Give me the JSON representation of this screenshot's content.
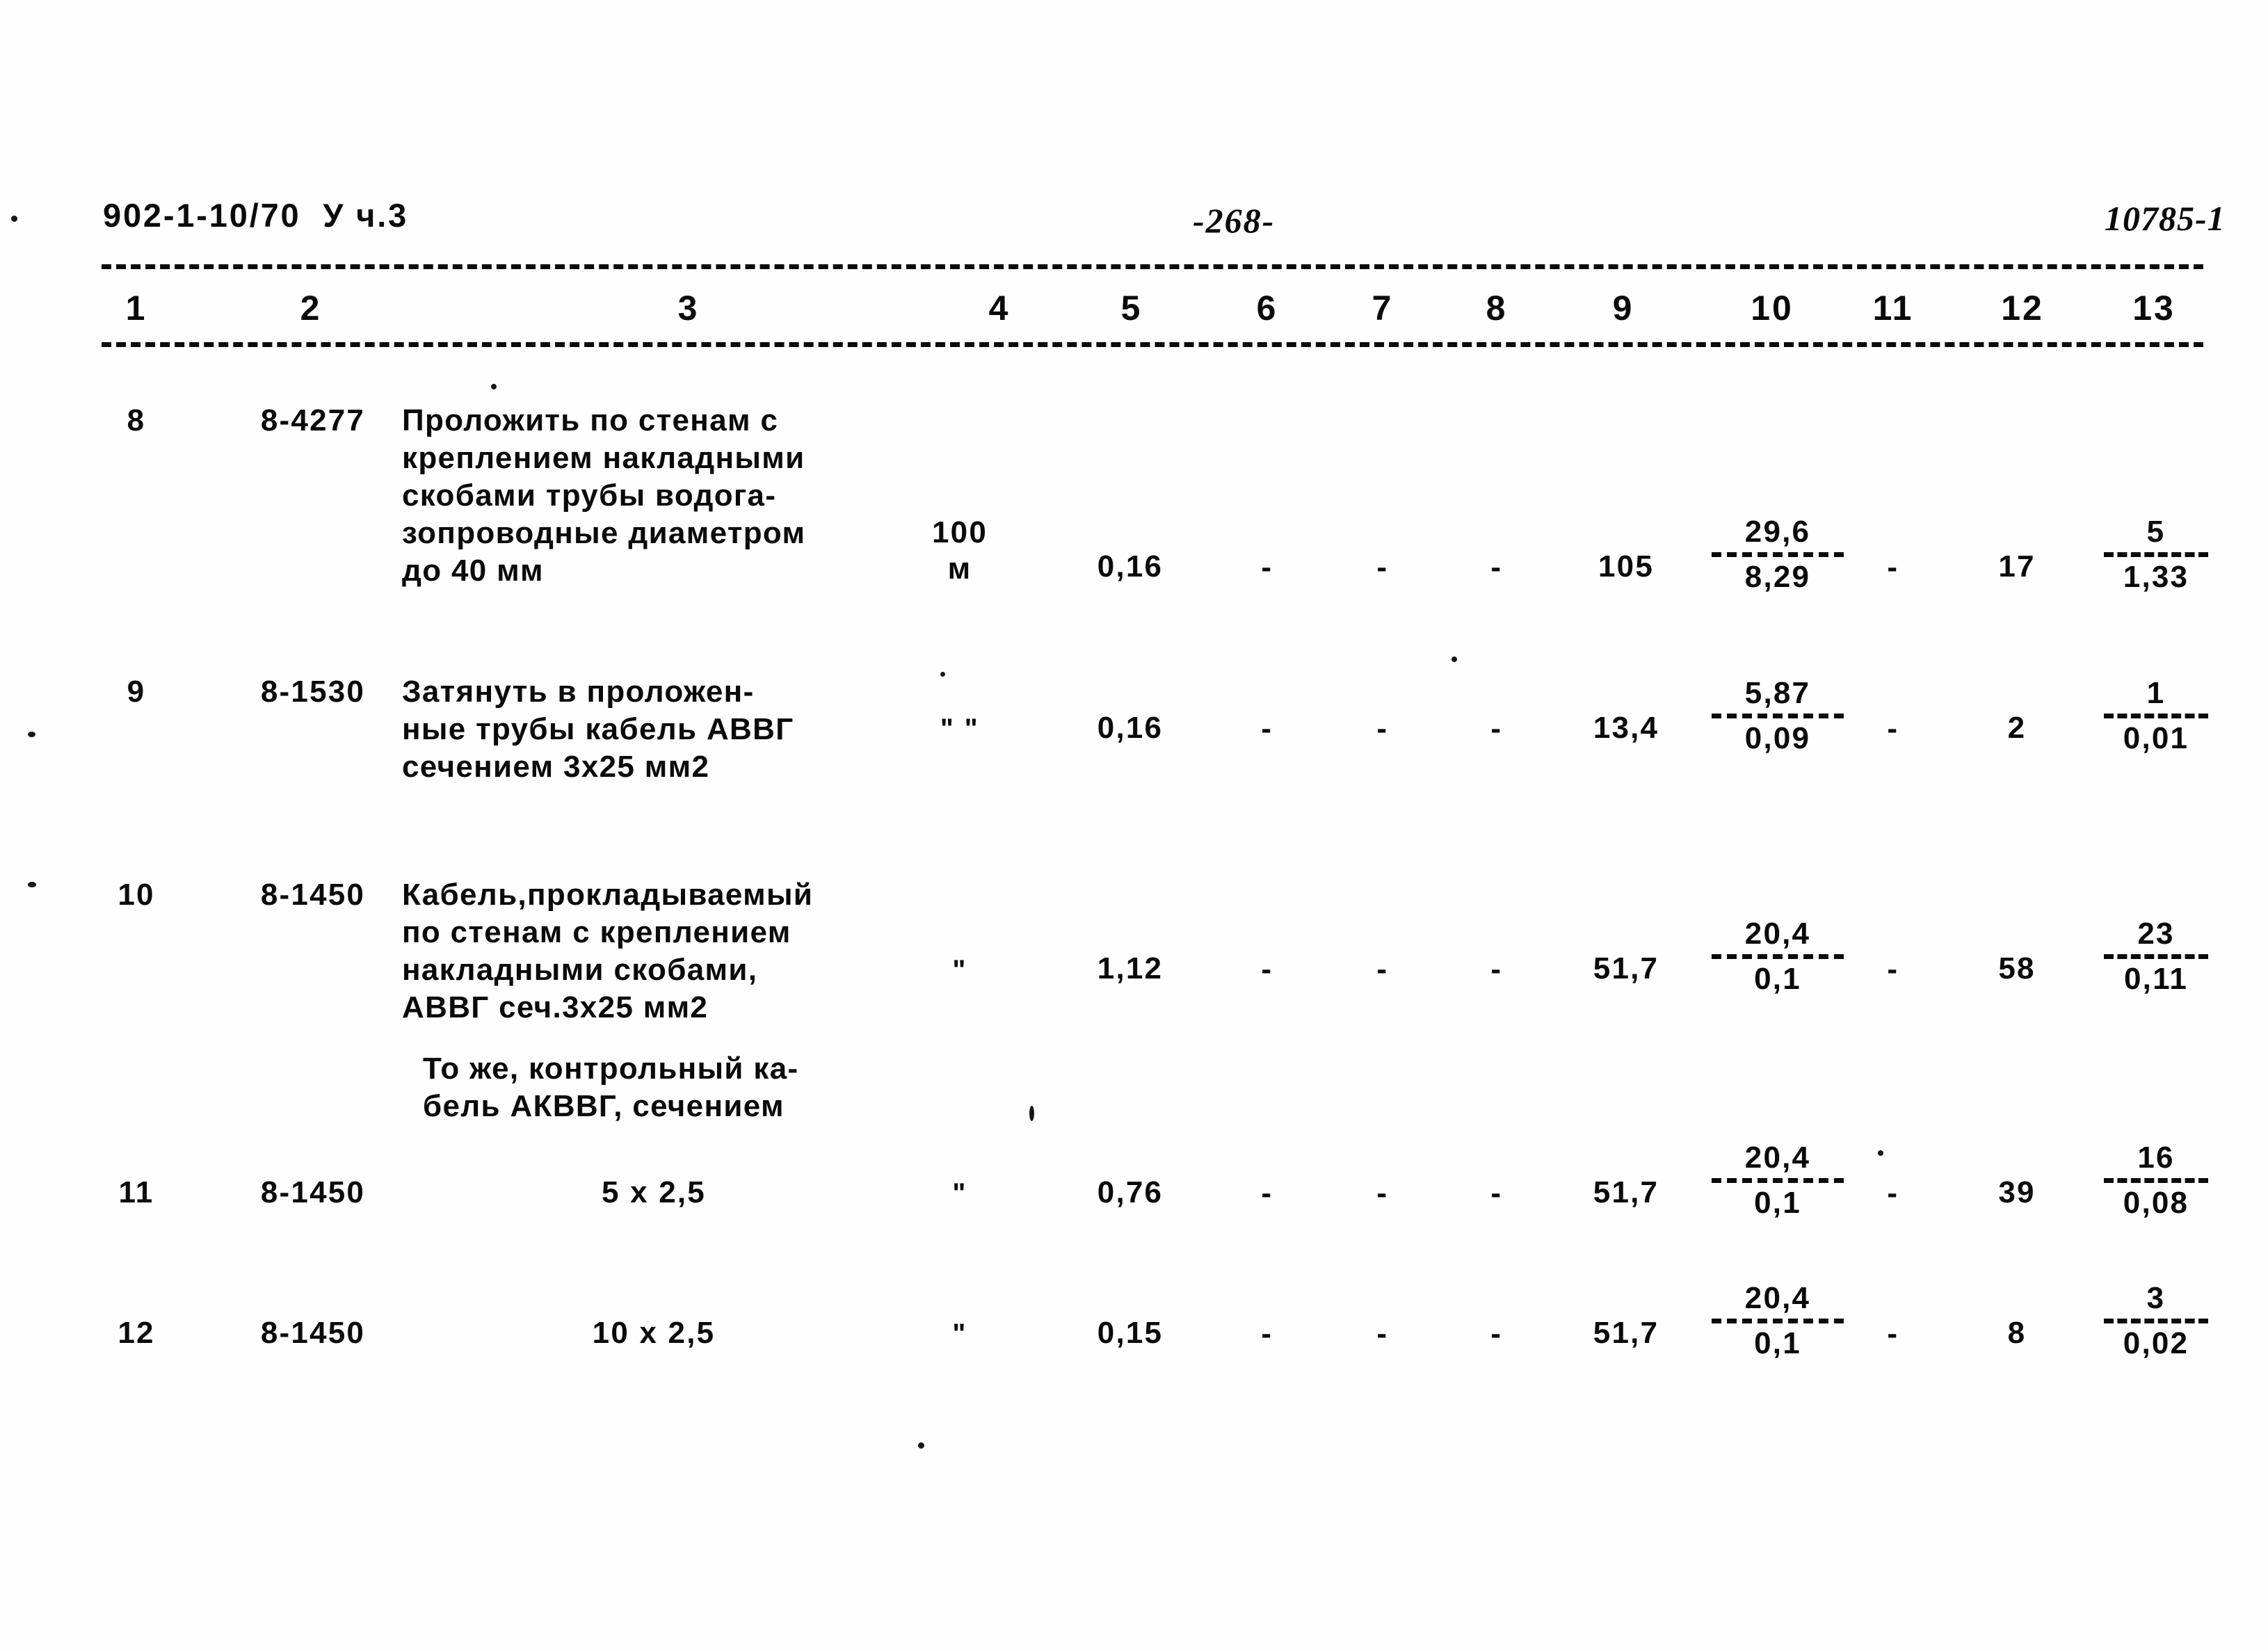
{
  "header": {
    "doc_code": "902-1-10/70  У ч.3",
    "page_number": "-268-",
    "sheet_code": "10785-1"
  },
  "table": {
    "column_numbers": [
      "1",
      "2",
      "3",
      "4",
      "5",
      "6",
      "7",
      "8",
      "9",
      "10",
      "11",
      "12",
      "13"
    ],
    "dash_mark": "-",
    "ditto_single": "\"",
    "ditto_double": "\" \"",
    "rows": [
      {
        "no": "8",
        "code": "8-4277",
        "description": "Проложить по стенам с\nкреплением накладными\nскобами трубы водога-\nзопроводные диаметром\nдо 40 мм",
        "unit": "100\nм",
        "c5": "0,16",
        "c6": "-",
        "c7": "-",
        "c8": "-",
        "c9": "105",
        "c10_num": "29,6",
        "c10_den": "8,29",
        "c11": "-",
        "c12": "17",
        "c13_num": "5",
        "c13_den": "1,33"
      },
      {
        "no": "9",
        "code": "8-1530",
        "description": "Затянуть в проложен-\nные трубы кабель АВВГ\nсечением 3х25 мм2",
        "unit": "\" \"",
        "c5": "0,16",
        "c6": "-",
        "c7": "-",
        "c8": "-",
        "c9": "13,4",
        "c10_num": "5,87",
        "c10_den": "0,09",
        "c11": "-",
        "c12": "2",
        "c13_num": "1",
        "c13_den": "0,01"
      },
      {
        "no": "10",
        "code": "8-1450",
        "description": "Кабель,прокладываемый\nпо стенам с креплением\nнакладными скобами,\nАВВГ сеч.3х25 мм2",
        "unit": "\"",
        "c5": "1,12",
        "c6": "-",
        "c7": "-",
        "c8": "-",
        "c9": "51,7",
        "c10_num": "20,4",
        "c10_den": "0,1",
        "c11": "-",
        "c12": "58",
        "c13_num": "23",
        "c13_den": "0,11"
      },
      {
        "no": "11",
        "code": "8-1450",
        "description": "5 х 2,5",
        "unit": "\"",
        "c5": "0,76",
        "c6": "-",
        "c7": "-",
        "c8": "-",
        "c9": "51,7",
        "c10_num": "20,4",
        "c10_den": "0,1",
        "c11": "-",
        "c12": "39",
        "c13_num": "16",
        "c13_den": "0,08"
      },
      {
        "no": "12",
        "code": "8-1450",
        "description": "10 х 2,5",
        "unit": "\"",
        "c5": "0,15",
        "c6": "-",
        "c7": "-",
        "c8": "-",
        "c9": "51,7",
        "c10_num": "20,4",
        "c10_den": "0,1",
        "c11": "-",
        "c12": "8",
        "c13_num": "3",
        "c13_den": "0,02"
      }
    ],
    "subheading": "То же, контрольный ка-\nбель АКВВГ, сечением"
  }
}
